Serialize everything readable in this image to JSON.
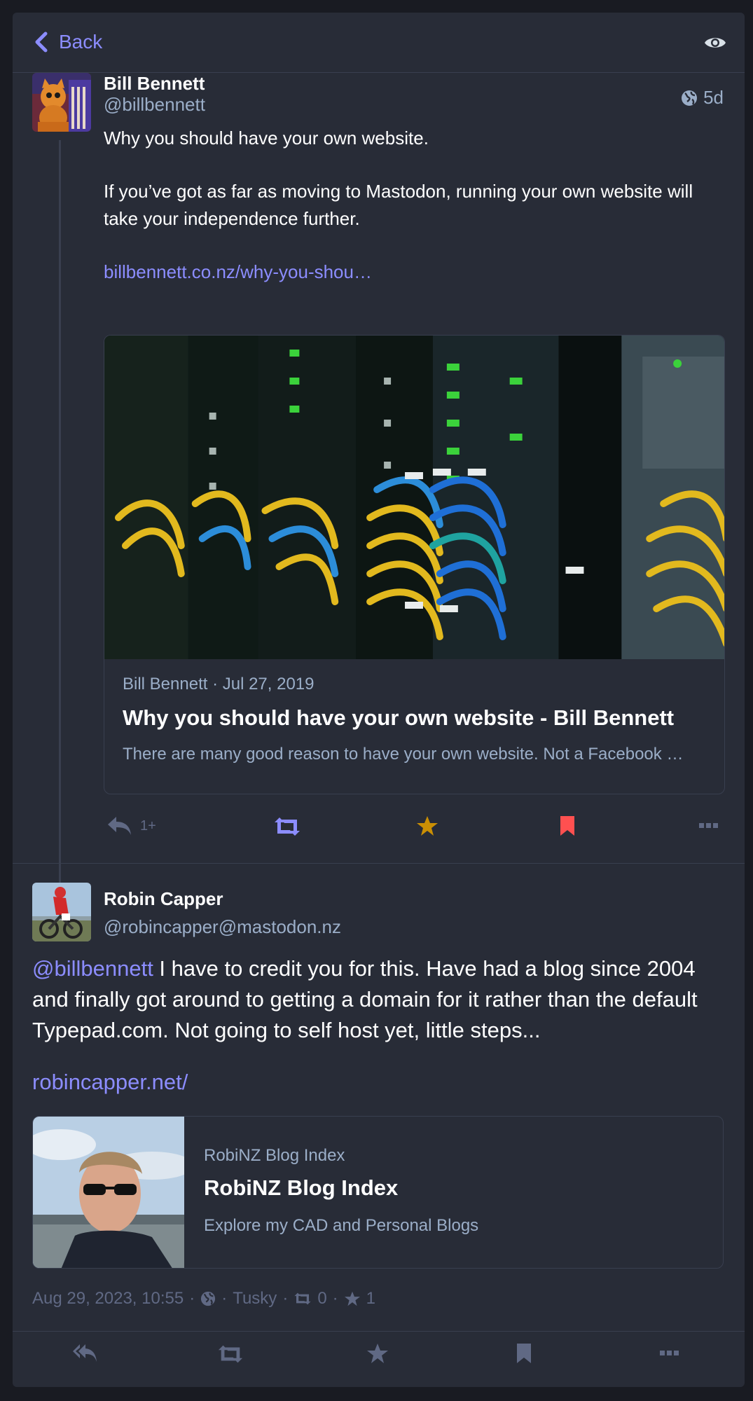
{
  "header": {
    "back_label": "Back"
  },
  "status1": {
    "display_name": "Bill Bennett",
    "acct": "@billbennett",
    "time_ago": "5d",
    "content": [
      "Why you should have your own website.",
      "If you’ve got as far as moving to Mastodon, running your own website will take your independence further."
    ],
    "link_text": "billbennett.co.nz/why-you-shou…",
    "card": {
      "meta": "Bill Bennett · Jul 27, 2019",
      "title": "Why you should have your own website - Bill Bennett",
      "description": "There are many good reason to have your own website. Not a Facebook …"
    },
    "actions": {
      "reply_count": "1+"
    },
    "colors": {
      "boost": "#8c8dff",
      "favourite": "#ca8f04",
      "bookmark": "#ff5050"
    }
  },
  "status2": {
    "display_name": "Robin Capper",
    "acct": "@robincapper@mastodon.nz",
    "content": "@billbennett I have to credit you for this. Have had a blog since 2004 and finally got around to getting a domain for it rather than the default Typepad.com. Not going to self host yet, little steps...",
    "mention": "@billbennett",
    "content_rest": " I have to credit you for this. Have had a blog since 2004 and finally got around to getting a domain for it rather than the default Typepad.com. Not going to self host yet, little steps...",
    "link_text": "robincapper.net/",
    "card": {
      "meta": "RobiNZ Blog Index",
      "title": "RobiNZ Blog Index",
      "description": "Explore my CAD and Personal Blogs"
    },
    "meta": {
      "datetime": "Aug 29, 2023, 10:55",
      "client": "Tusky",
      "boosts": "0",
      "favourites": "1"
    }
  },
  "icons": [
    "chevron-left-icon",
    "eye-icon",
    "globe-icon",
    "reply-icon",
    "reply-all-icon",
    "boost-icon",
    "star-icon",
    "bookmark-icon",
    "more-icon"
  ]
}
